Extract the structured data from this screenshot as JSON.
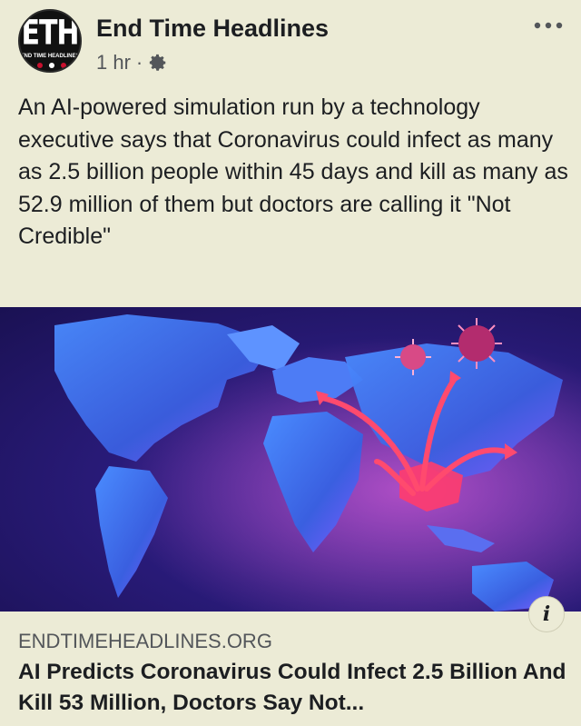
{
  "post": {
    "page_name": "End Time Headlines",
    "avatar_text": "ETH",
    "avatar_subtext": "END TIME HEADLINES",
    "time": "1 hr",
    "separator": "·",
    "privacy_icon": "gear-icon",
    "more_icon": "more-horizontal-icon",
    "text": "An AI-powered simulation run by a technology executive says that Coronavirus could infect as many as 2.5 billion people within 45 days and kill as many as 52.9 million of them but doctors are calling it \"Not Credible\""
  },
  "link": {
    "domain": "ENDTIMEHEADLINES.ORG",
    "title": "AI Predicts Coronavirus Could Infect 2.5 Billion And Kill 53 Million, Doctors Say Not...",
    "info_icon": "info-icon",
    "info_label": "i"
  },
  "colors": {
    "background": "#ecebd6",
    "text": "#1c1e21",
    "secondary": "#53565a",
    "map_blue": "#3a6ee8",
    "hotspot": "#ff3c6e"
  }
}
